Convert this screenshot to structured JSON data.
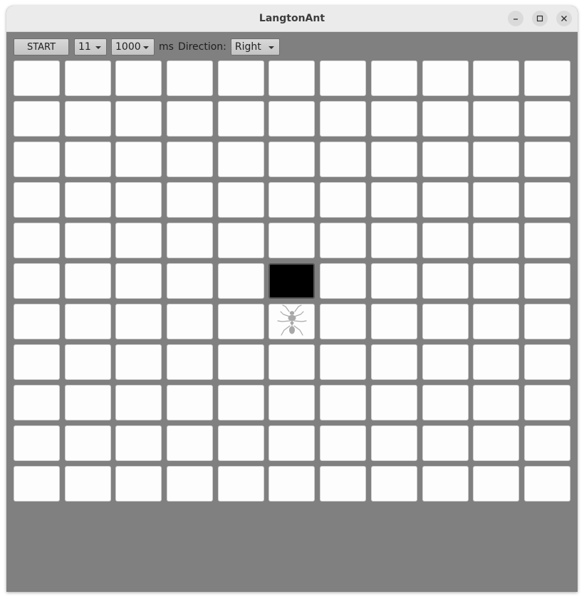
{
  "window": {
    "title": "LangtonAnt",
    "controls": {
      "minimize_icon": "minimize-icon",
      "maximize_icon": "maximize-icon",
      "close_icon": "close-icon"
    }
  },
  "toolbar": {
    "start_label": "START",
    "grid_size": "11",
    "delay": "1000",
    "delay_unit": "ms",
    "direction_label": "Direction:",
    "direction": "Right"
  },
  "board": {
    "size": 11,
    "black_cells": [
      [
        5,
        5
      ]
    ],
    "ant": {
      "row": 6,
      "col": 5,
      "icon": "ant-icon"
    },
    "colors": {
      "background": "#808080",
      "white_cell": "#fdfdfd",
      "black_cell": "#000000",
      "ant": "#a8a8a8"
    }
  }
}
